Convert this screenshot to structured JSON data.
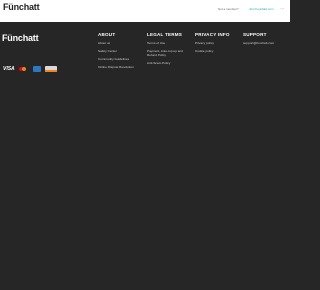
{
  "header": {
    "logo": "Fünchatt",
    "member_text": "Not a member?",
    "join_text": "Join Funchatt.com",
    "more_icon": "···"
  },
  "footer": {
    "logo": "Fünchatt",
    "payment_icons": [
      "visa-card-icon",
      "mastercard-icon",
      "amex-card-icon",
      "discover-card-icon"
    ],
    "visa_label": "VISA",
    "columns": {
      "about": {
        "title": "ABOUT",
        "links": [
          "About us",
          "Safety Center",
          "Community Guidelines",
          "Online Dispute Resolution"
        ]
      },
      "legal": {
        "title": "LEGAL TERMS",
        "links": [
          "Terms of Use",
          "Payment, Auto-top-up and Refund Policy",
          "Anti-Scam Policy"
        ]
      },
      "privacy": {
        "title": "PRIVACY INFO",
        "links": [
          "Privacy policy",
          "Cookie policy"
        ]
      },
      "support": {
        "title": "SUPPORT",
        "links": [
          "support@funchatt.com"
        ]
      }
    }
  },
  "colors": {
    "header_bg": "#ffffff",
    "footer_bg": "#262626",
    "accent": "#1aa3a3"
  }
}
